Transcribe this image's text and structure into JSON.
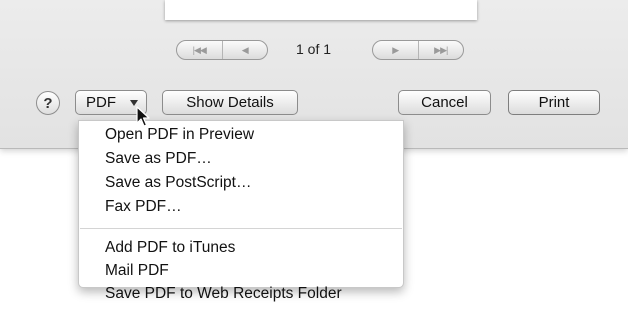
{
  "pagination": {
    "page_label": "1 of 1",
    "prev_glyphs": [
      "|◀◀",
      "◀"
    ],
    "next_glyphs": [
      "▶",
      "▶▶|"
    ]
  },
  "footer": {
    "help_label": "?",
    "pdf_label": "PDF",
    "show_details_label": "Show Details",
    "cancel_label": "Cancel",
    "print_label": "Print"
  },
  "pdf_menu": {
    "items": [
      "Open PDF in Preview",
      "Save as PDF…",
      "Save as PostScript…",
      "Fax PDF…",
      "Add PDF to iTunes",
      "Mail PDF",
      "Save PDF to Web Receipts Folder"
    ]
  },
  "icons": {
    "first_page": "first-page-icon",
    "prev_page": "previous-page-icon",
    "next_page": "next-page-icon",
    "last_page": "last-page-icon",
    "pdf_dropdown": "chevron-down-icon",
    "cursor": "mouse-pointer-icon"
  }
}
